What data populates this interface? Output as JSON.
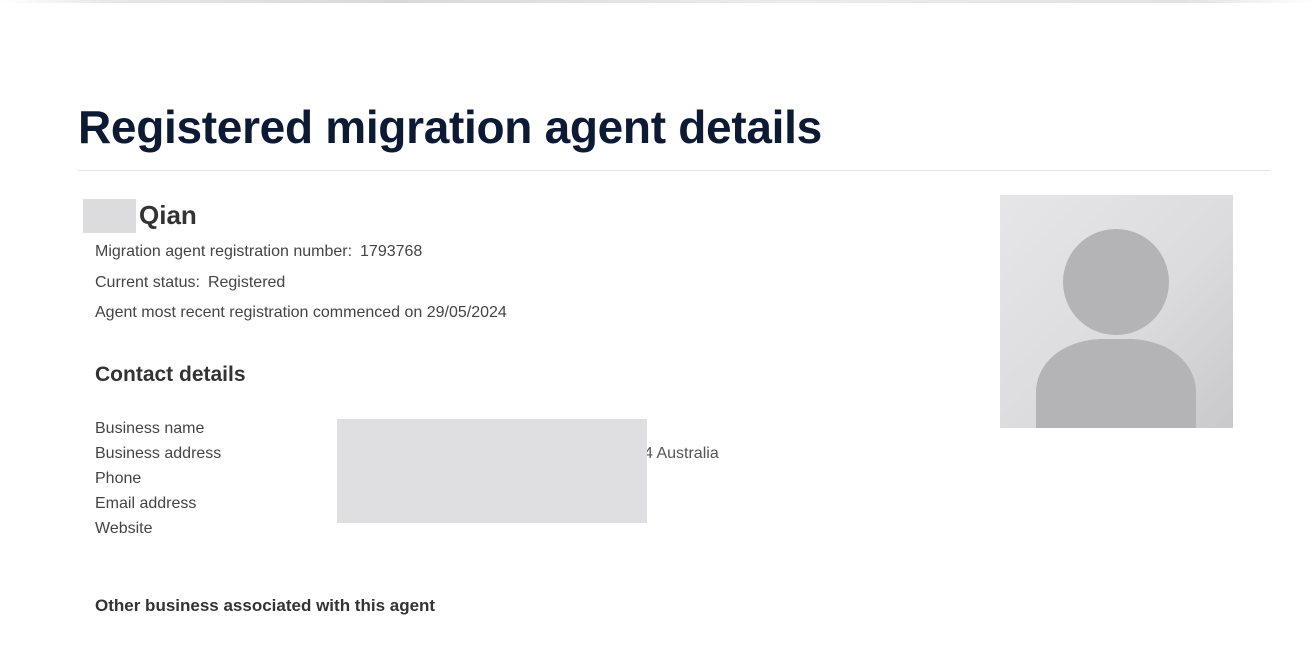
{
  "page": {
    "title": "Registered migration agent details"
  },
  "agent": {
    "name": "Qian",
    "registration_label": "Migration agent registration number:",
    "registration_number": "1793768",
    "status_label": "Current status:",
    "status_value": "Registered",
    "recent_registration": "Agent most recent registration commenced on 29/05/2024"
  },
  "contact": {
    "heading": "Contact details",
    "labels": {
      "business_name": "Business name",
      "business_address": "Business address",
      "phone": "Phone",
      "email": "Email address",
      "website": "Website"
    },
    "business_address_visible": "4 Australia"
  },
  "other_business": {
    "heading": "Other business associated with this agent"
  },
  "icons": {
    "avatar": "user-silhouette-icon"
  },
  "colors": {
    "title": "#0c1a33",
    "text": "#444444",
    "redaction": "#dfdfe1",
    "avatar_bg": "#dcdcde",
    "avatar_figure": "#b4b4b6"
  }
}
